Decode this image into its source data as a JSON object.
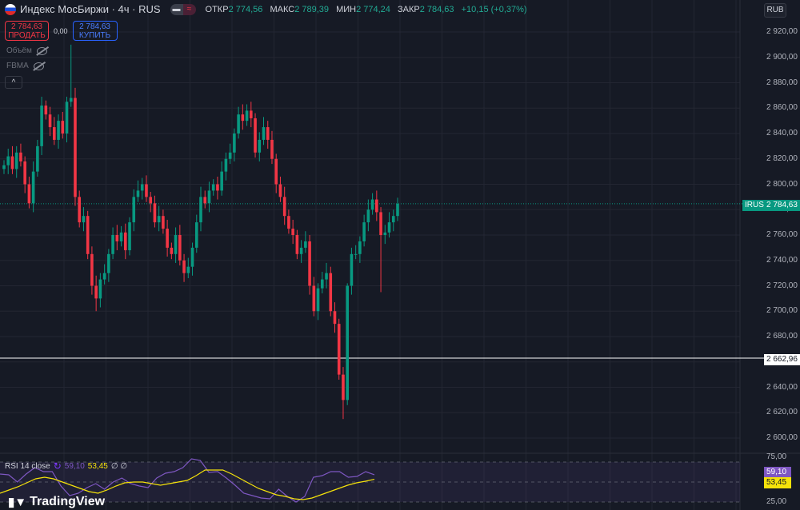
{
  "header": {
    "symbol": "Индекс МосБиржи · 4ч · RUS",
    "open_label": "ОТКР",
    "open": "2 774,56",
    "high_label": "МАКС",
    "high": "2 789,39",
    "low_label": "МИН",
    "low": "2 774,24",
    "close_label": "ЗАКР",
    "close": "2 784,63",
    "change": "+10,15 (+0,37%)"
  },
  "trade": {
    "sell_price": "2 784,63",
    "sell_label": "ПРОДАТЬ",
    "spread": "0,00",
    "buy_price": "2 784,63",
    "buy_label": "КУПИТЬ"
  },
  "indicators": [
    {
      "label": "Объём"
    },
    {
      "label": "FBMA"
    }
  ],
  "currency": "RUB",
  "colors": {
    "up": "#089981",
    "down": "#f23645",
    "bg": "#161a25",
    "rsi": "#7e57c2",
    "rsi_ma": "#f5e20a"
  },
  "price_axis": {
    "ticks": [
      "2 920,00",
      "2 900,00",
      "2 880,00",
      "2 860,00",
      "2 840,00",
      "2 820,00",
      "2 800,00",
      "2 780,00",
      "2 760,00",
      "2 740,00",
      "2 720,00",
      "2 700,00",
      "2 680,00",
      "2 660,00",
      "2 640,00",
      "2 620,00",
      "2 600,00"
    ],
    "symbol_label": "IRUS",
    "last_price": "2 784,63",
    "line_price": "2 662,96"
  },
  "rsi": {
    "label": "RSI 14 close",
    "value": "59,10",
    "ma_value": "53,45",
    "extra": "∅ ∅",
    "ticks": [
      "75,00",
      "25,00"
    ]
  },
  "branding": "TradingView",
  "chart_data": {
    "type": "candlestick",
    "ylim": [
      2600,
      2920
    ],
    "first_open": 2812,
    "closes": [
      2815,
      2822,
      2812,
      2825,
      2818,
      2800,
      2785,
      2810,
      2830,
      2862,
      2855,
      2845,
      2835,
      2850,
      2840,
      2865,
      2868,
      2790,
      2770,
      2775,
      2745,
      2720,
      2710,
      2725,
      2730,
      2745,
      2760,
      2755,
      2762,
      2748,
      2770,
      2790,
      2795,
      2800,
      2790,
      2785,
      2770,
      2775,
      2765,
      2750,
      2745,
      2760,
      2740,
      2730,
      2735,
      2750,
      2770,
      2790,
      2785,
      2795,
      2800,
      2795,
      2810,
      2820,
      2825,
      2840,
      2855,
      2850,
      2858,
      2852,
      2825,
      2835,
      2845,
      2835,
      2820,
      2800,
      2790,
      2775,
      2765,
      2760,
      2745,
      2750,
      2755,
      2720,
      2700,
      2718,
      2725,
      2730,
      2700,
      2690,
      2650,
      2630,
      2720,
      2745,
      2745,
      2755,
      2770,
      2780,
      2788,
      2778,
      2760,
      2762,
      2770,
      2775,
      2784.63
    ],
    "special_highs": {
      "16": 2910,
      "82": 2722,
      "94": 2789.39
    },
    "special_lows": {
      "81": 2615,
      "90": 2715,
      "22": 2700
    },
    "horizontal_line": 2662.96,
    "rsi_series": [
      60,
      59,
      50,
      60,
      68,
      63,
      63,
      45,
      33,
      36,
      43,
      48,
      41,
      50,
      55,
      48,
      45,
      43,
      55,
      61,
      63,
      68,
      79,
      77,
      62,
      63,
      55,
      46,
      36,
      33,
      30,
      29,
      41,
      32,
      25,
      32,
      56,
      58,
      63,
      63,
      56,
      57,
      63,
      59.1
    ],
    "rsi_ma_series": [
      36,
      40,
      44,
      49,
      54,
      56,
      54,
      50,
      46,
      42,
      38,
      36,
      40,
      45,
      49,
      50,
      50,
      48,
      46,
      48,
      50,
      52,
      58,
      65,
      65,
      65,
      60,
      54,
      48,
      42,
      38,
      34,
      32,
      29,
      28,
      30,
      34,
      38,
      42,
      46,
      49,
      51,
      53.45
    ],
    "rsi_ylim": [
      25,
      75
    ]
  }
}
